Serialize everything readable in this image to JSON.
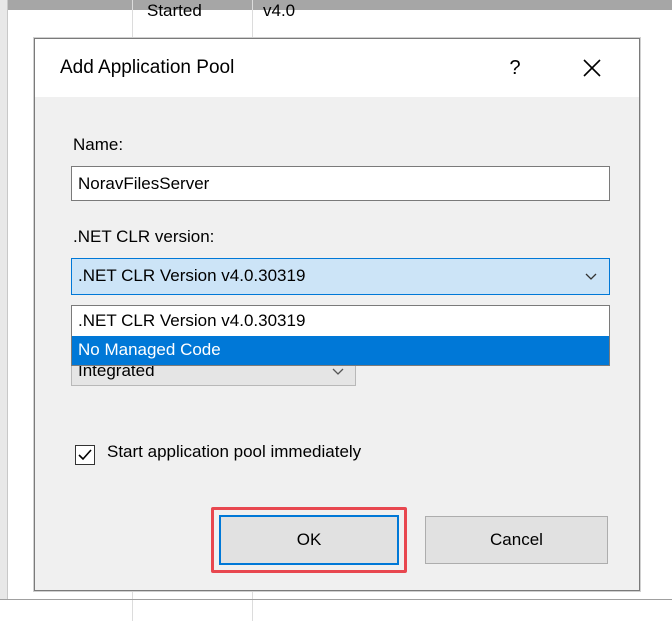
{
  "background": {
    "status": "Started",
    "version": "v4.0"
  },
  "dialog": {
    "title": "Add Application Pool",
    "help_label": "?",
    "close_icon": "close-icon",
    "name_label": "Name:",
    "name_value": "NoravFilesServer",
    "clr_label": ".NET CLR version:",
    "clr_selected": ".NET CLR Version v4.0.30319",
    "clr_options": [
      ".NET CLR Version v4.0.30319",
      "No Managed Code"
    ],
    "clr_highlighted": "No Managed Code",
    "pipeline_mode": "Integrated",
    "start_immediately_label": "Start application pool immediately",
    "start_immediately_checked": true,
    "ok_label": "OK",
    "cancel_label": "Cancel"
  },
  "colors": {
    "accent": "#0078d7",
    "highlight_outline": "#e8474f",
    "selected_field_bg": "#cce4f7"
  }
}
